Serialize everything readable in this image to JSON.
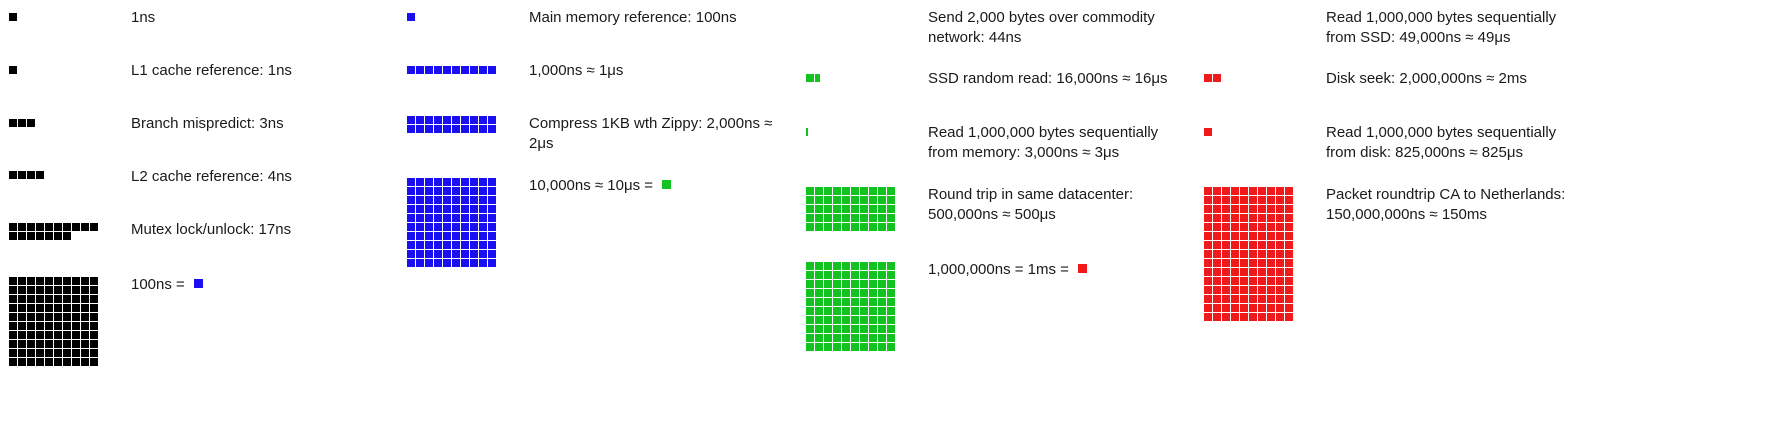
{
  "colors": {
    "black": "#000000",
    "blue": "#1a0ff0",
    "green": "#12c322",
    "red": "#f01a1a"
  },
  "columns": [
    {
      "entries": [
        {
          "label": "1ns",
          "color": "black",
          "filled": 1,
          "swatch": null
        },
        {
          "label": "L1 cache reference: 1ns",
          "color": "black",
          "filled": 1,
          "swatch": null
        },
        {
          "label": "Branch mispredict: 3ns",
          "color": "black",
          "filled": 3,
          "swatch": null
        },
        {
          "label": "L2 cache reference: 4ns",
          "color": "black",
          "filled": 4,
          "swatch": null
        },
        {
          "label": "Mutex lock/unlock: 17ns",
          "color": "black",
          "filled": 17,
          "swatch": null
        },
        {
          "label": "100ns = ",
          "color": "black",
          "filled": 100,
          "swatch": "blue"
        }
      ]
    },
    {
      "entries": [
        {
          "label": "Main memory reference: 100ns",
          "color": "blue",
          "filled": 1,
          "swatch": null
        },
        {
          "label": "1,000ns ≈ 1μs",
          "color": "blue",
          "filled": 10,
          "swatch": null
        },
        {
          "label": "Compress 1KB wth Zippy: 2,000ns ≈ 2μs",
          "color": "blue",
          "filled": 20,
          "swatch": null
        },
        {
          "label": "10,000ns ≈ 10μs = ",
          "color": "blue",
          "filled": 100,
          "swatch": "green"
        }
      ]
    },
    {
      "entries": [
        {
          "label": "Send 2,000 bytes over commodity network: 44ns",
          "color": "green",
          "filled": 0,
          "swatch": null
        },
        {
          "label": "SSD random read: 16,000ns ≈ 16μs",
          "color": "green",
          "filled": 1.6,
          "swatch": null
        },
        {
          "label": "Read 1,000,000 bytes sequentially from memory: 3,000ns ≈ 3μs",
          "color": "green",
          "filled": 0.3,
          "swatch": null
        },
        {
          "label": "Round trip in same datacenter: 500,000ns ≈ 500μs",
          "color": "green",
          "filled": 50,
          "swatch": null
        },
        {
          "label": "1,000,000ns = 1ms = ",
          "color": "green",
          "filled": 100,
          "swatch": "red"
        }
      ]
    },
    {
      "entries": [
        {
          "label": "Read 1,000,000 bytes sequentially from SSD: 49,000ns ≈ 49μs",
          "color": "red",
          "filled": 0,
          "swatch": null
        },
        {
          "label": "Disk seek: 2,000,000ns ≈ 2ms",
          "color": "red",
          "filled": 2,
          "swatch": null
        },
        {
          "label": "Read 1,000,000 bytes sequentially from disk: 825,000ns ≈ 825μs",
          "color": "red",
          "filled": 1,
          "swatch": null
        },
        {
          "label": "Packet roundtrip CA to Netherlands: 150,000,000ns ≈ 150ms",
          "color": "red",
          "filled": 150,
          "swatch": null
        }
      ]
    }
  ]
}
